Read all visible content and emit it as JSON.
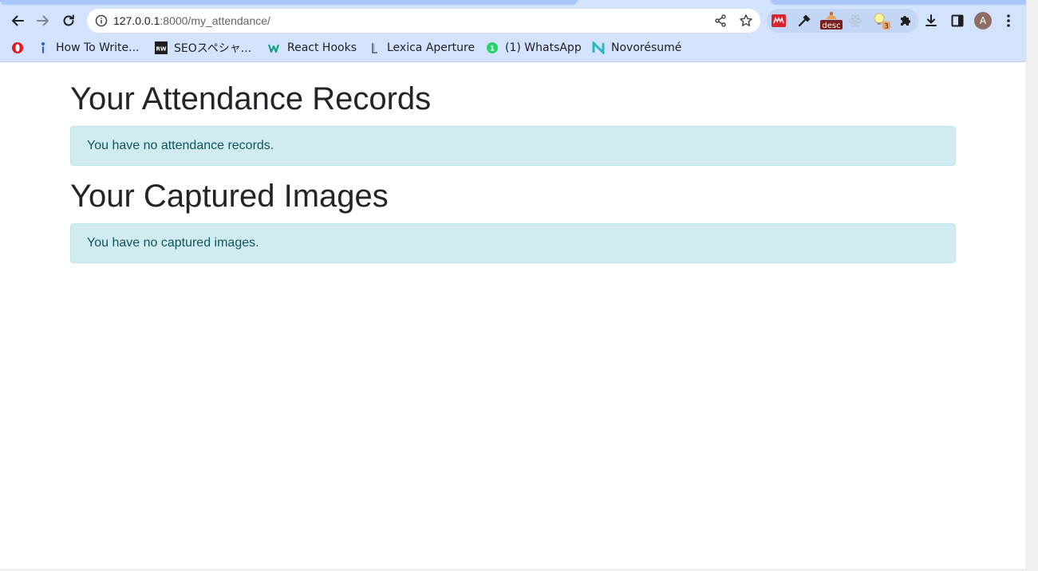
{
  "browser": {
    "url_host": "127.0.0.1",
    "url_path": ":8000/my_attendance/",
    "profile_initial": "A",
    "extension_badge_text": "desc",
    "extension_count_badge": "3",
    "bookmarks": [
      {
        "label": "How To Write...",
        "icon": "pen-nib-icon"
      },
      {
        "label": "SEOスペシャ...",
        "icon": "rw-icon"
      },
      {
        "label": "React Hooks",
        "icon": "w-logo-icon"
      },
      {
        "label": "Lexica Aperture",
        "icon": "lexica-icon"
      },
      {
        "label": "(1) WhatsApp",
        "icon": "whatsapp-icon"
      },
      {
        "label": "Novorésumé",
        "icon": "n-logo-icon"
      }
    ]
  },
  "page": {
    "attendance_heading": "Your Attendance Records",
    "attendance_empty_message": "You have no attendance records.",
    "images_heading": "Your Captured Images",
    "images_empty_message": "You have no captured images."
  },
  "colors": {
    "chrome_bg": "#d3e3fd",
    "alert_bg": "#d1ecf1",
    "alert_border": "#bee5eb",
    "alert_text": "#0c5460",
    "heading_text": "#212529"
  }
}
